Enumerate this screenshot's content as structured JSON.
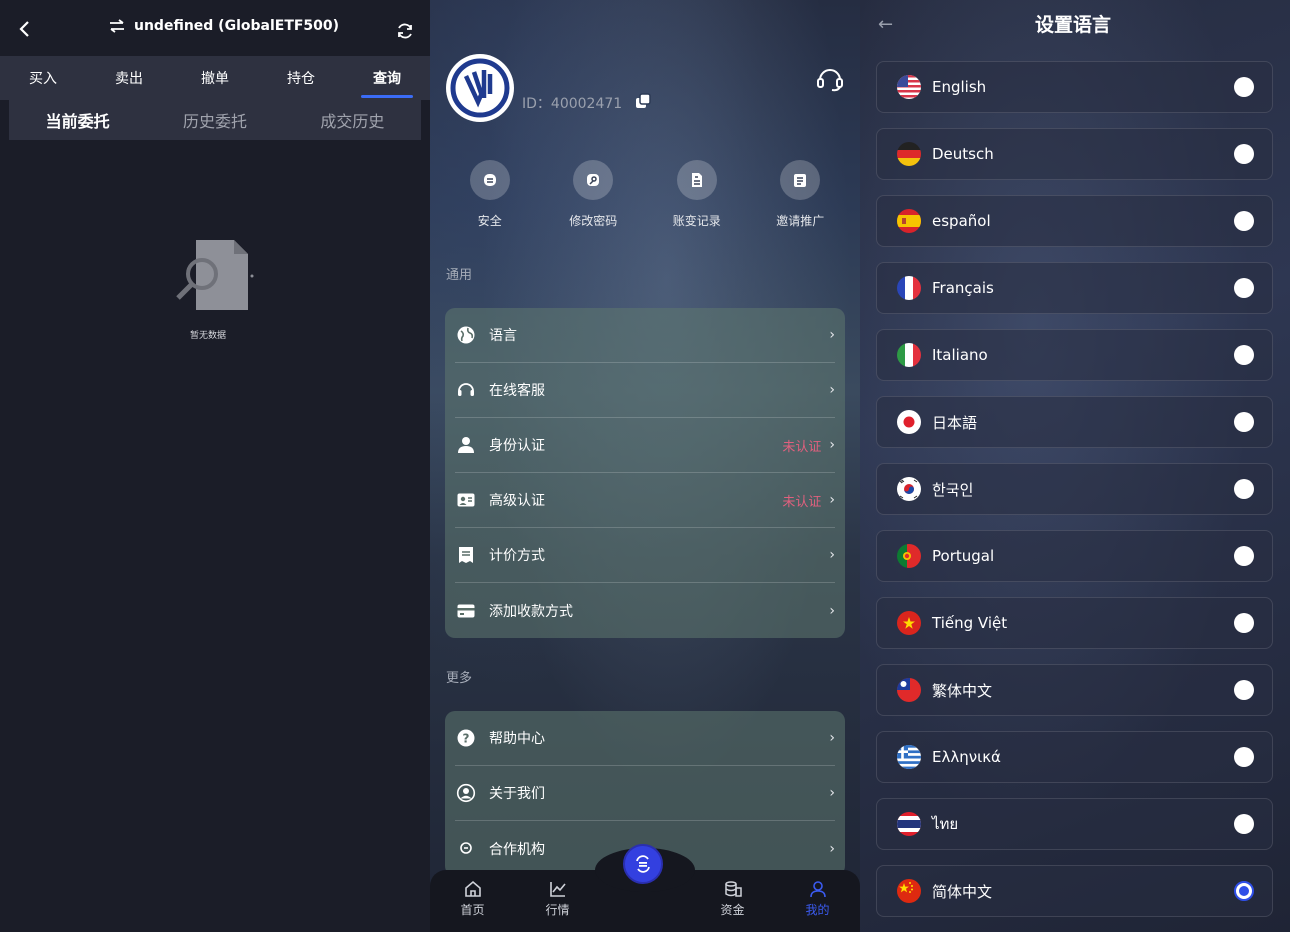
{
  "trade_panel": {
    "title": "undefined (GlobalETF500)",
    "tabs": [
      "买入",
      "卖出",
      "撤单",
      "持仓",
      "查询"
    ],
    "active_tab": "查询",
    "subtabs": [
      "当前委托",
      "历史委托",
      "成交历史"
    ],
    "active_subtab": "当前委托",
    "empty_text": "暂无数据"
  },
  "profile_panel": {
    "user_id": "ID：40002471",
    "quick_actions": [
      "安全",
      "修改密码",
      "账变记录",
      "邀请推广"
    ],
    "section_general": "通用",
    "general_items": [
      {
        "label": "语言",
        "status": ""
      },
      {
        "label": "在线客服",
        "status": ""
      },
      {
        "label": "身份认证",
        "status": "未认证"
      },
      {
        "label": "高级认证",
        "status": "未认证"
      },
      {
        "label": "计价方式",
        "status": ""
      },
      {
        "label": "添加收款方式",
        "status": ""
      }
    ],
    "section_more": "更多",
    "more_items": [
      {
        "label": "帮助中心"
      },
      {
        "label": "关于我们"
      },
      {
        "label": "合作机构"
      }
    ],
    "bottom_nav": [
      "首页",
      "行情",
      "资金",
      "我的"
    ],
    "active_nav": "我的",
    "accent_color": "#3b5bf0",
    "warn_color": "#e0607e"
  },
  "language_panel": {
    "title": "设置语言",
    "languages": [
      {
        "name": "English",
        "selected": false
      },
      {
        "name": "Deutsch",
        "selected": false
      },
      {
        "name": "español",
        "selected": false
      },
      {
        "name": "Français",
        "selected": false
      },
      {
        "name": "Italiano",
        "selected": false
      },
      {
        "name": "日本語",
        "selected": false
      },
      {
        "name": "한국인",
        "selected": false
      },
      {
        "name": "Portugal",
        "selected": false
      },
      {
        "name": "Tiếng Việt",
        "selected": false
      },
      {
        "name": "繁体中文",
        "selected": false
      },
      {
        "name": "Ελληνικά",
        "selected": false
      },
      {
        "name": "ไทย",
        "selected": false
      },
      {
        "name": "简体中文",
        "selected": true
      }
    ]
  }
}
